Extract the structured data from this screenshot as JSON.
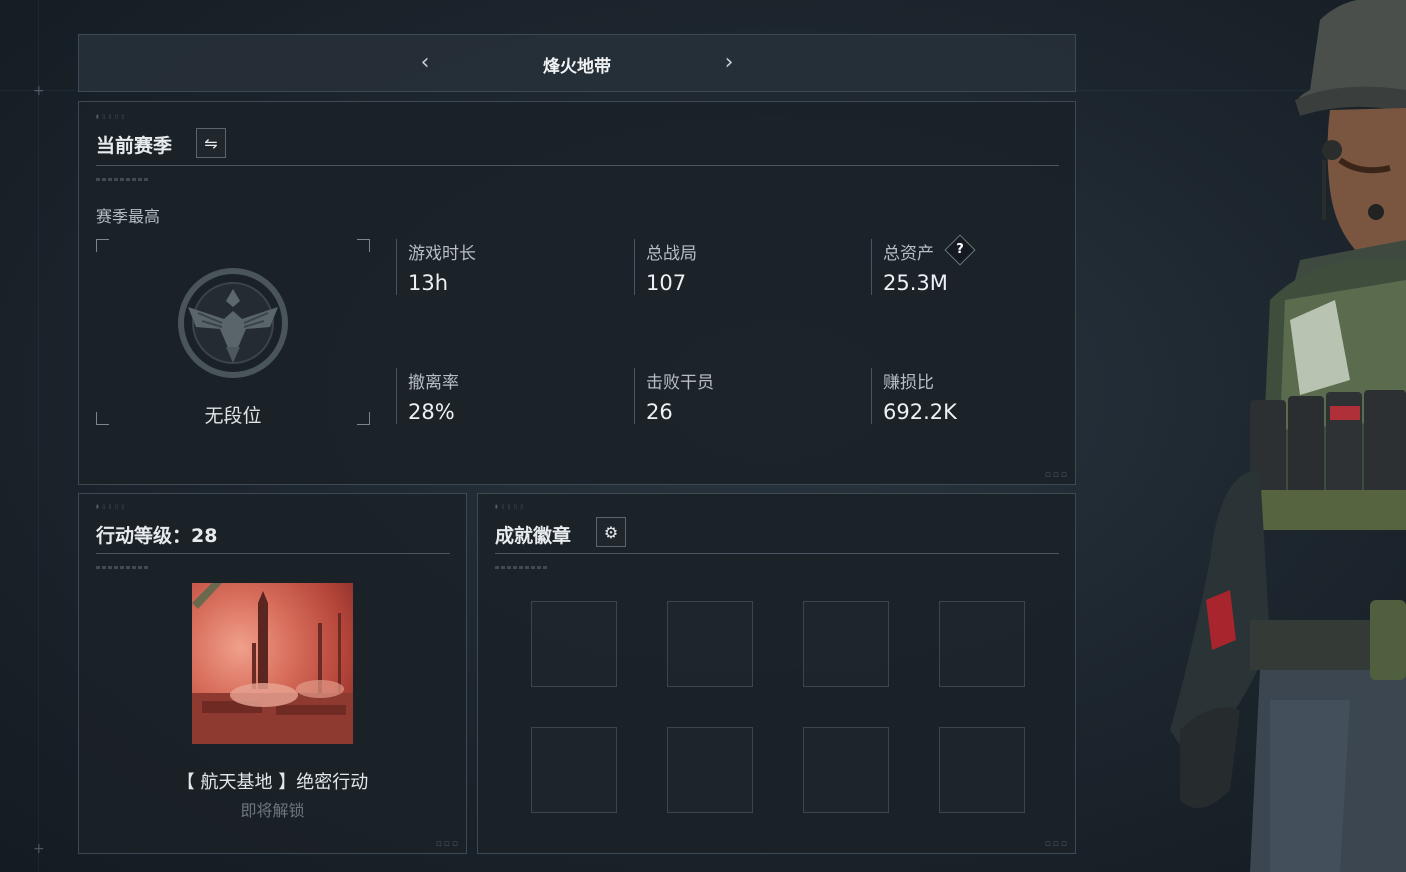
{
  "header": {
    "title": "烽火地带",
    "prev_icon": "chevron-left-icon",
    "next_icon": "chevron-right-icon"
  },
  "season": {
    "title": "当前赛季",
    "switch_icon": "swap-icon",
    "subtitle": "赛季最高",
    "rank_icon": "eagle-emblem-icon",
    "rank": "无段位",
    "stats": [
      {
        "label": "游戏时长",
        "value": "13h"
      },
      {
        "label": "总战局",
        "value": "107"
      },
      {
        "label": "总资产",
        "value": "25.3M",
        "help": "?"
      },
      {
        "label": "撤离率",
        "value": "28%"
      },
      {
        "label": "击败干员",
        "value": "26"
      },
      {
        "label": "赚损比",
        "value": "692.2K"
      }
    ]
  },
  "level": {
    "title": "行动等级：28",
    "operation": "【 航天基地 】绝密行动",
    "status": "即将解锁"
  },
  "badges": {
    "title": "成就徽章",
    "settings_icon": "gear-icon",
    "slot_count": 8
  },
  "colors": {
    "accent_red": "#d86e5c",
    "panel_bg": "#1a2127",
    "border": "#3e4a53"
  }
}
